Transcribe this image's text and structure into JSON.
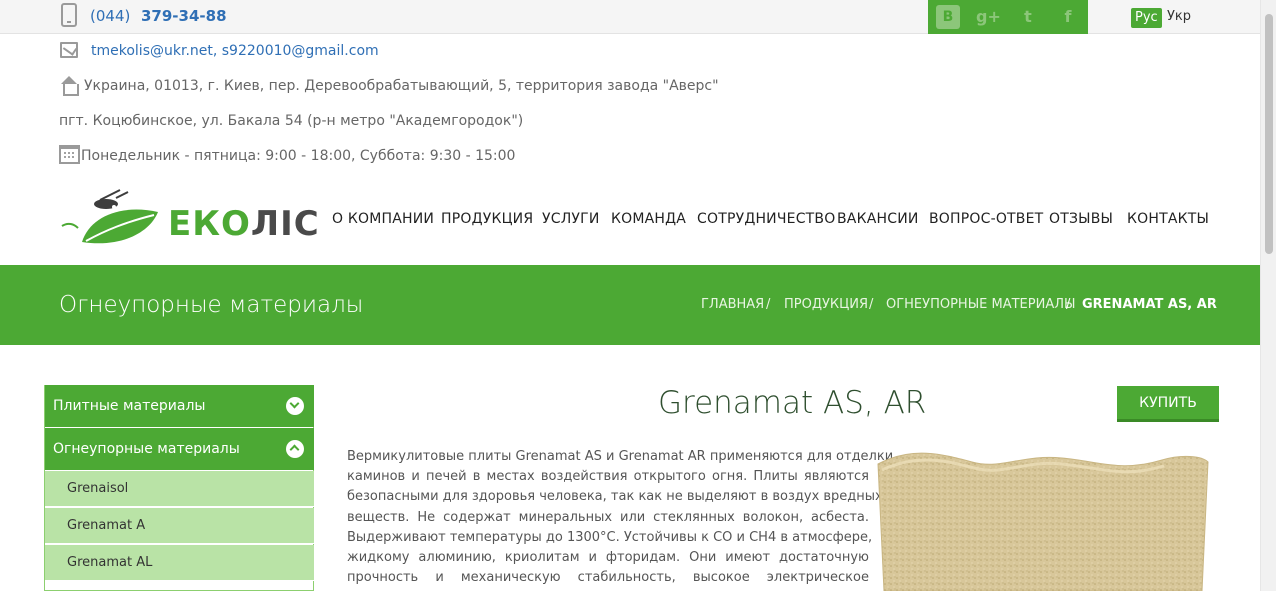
{
  "topbar": {
    "phone_icon": "mobile-phone-icon",
    "phone_code": "(044)",
    "phone_number": "379-34-88",
    "social_icons": [
      "vk-icon",
      "google-plus-icon",
      "twitter-icon",
      "facebook-icon"
    ],
    "social_glyphs": {
      "vk": "В",
      "gplus": "g+",
      "twitter": "t",
      "facebook": "f"
    },
    "lang_active": "Рус",
    "lang_other": "Укр"
  },
  "contacts": {
    "email": "tmekolis@ukr.net, s9220010@gmail.com",
    "address1": "Украина, 01013, г. Киев, пер. Деревообрабатывающий, 5, территория завода \"Аверс\"",
    "address2": "пгт. Коцюбинское, ул. Бакала 54 (р-н метро \"Академгородок\")",
    "hours": "Понедельник - пятница: 9:00 - 18:00, Суббота: 9:30 - 15:00"
  },
  "logo": {
    "text_a": "ЕКО",
    "text_b": "ЛІС"
  },
  "nav": [
    "О КОМПАНИИ",
    "ПРОДУКЦИЯ",
    "УСЛУГИ",
    "КОМАНДА",
    "СОТРУДНИЧЕСТВО",
    "ВАКАНСИИ",
    "ВОПРОС-ОТВЕТ",
    "ОТЗЫВЫ",
    "КОНТАКТЫ"
  ],
  "banner": {
    "title": "Огнеупорные материалы",
    "breadcrumbs": [
      "ГЛАВНАЯ",
      "ПРОДУКЦИЯ",
      "ОГНЕУПОРНЫЕ МАТЕРИАЛЫ",
      "GRENAMAT AS, AR"
    ],
    "separator": "/"
  },
  "sidebar": {
    "sections": [
      {
        "label": "Плитные материалы",
        "state": "collapsed"
      },
      {
        "label": "Огнеупорные материалы",
        "state": "expanded"
      }
    ],
    "items": [
      "Grenaisol",
      "Grenamat A",
      "Grenamat AL"
    ]
  },
  "product": {
    "title": "Grenamat AS, AR",
    "buy_label": "КУПИТЬ",
    "description_lines": [
      "Вермикулитовые плиты Grenamat AS и Grenamat AR применяются для отделки",
      "каминов и печей в местах воздействия открытого огня. Плиты являются",
      "безопасными для здоровья человека, так как не выделяют в воздух вредных",
      "веществ. Не содержат минеральных или стеклянных волокон, асбеста.",
      "Выдерживают температуры до 1300°C. Устойчивы к CO и CH4 в атмосфере,",
      "жидкому алюминию, криолитам и фторидам. Они имеют достаточную",
      "прочность и механическую стабильность, высокое электрическое"
    ]
  },
  "colors": {
    "brand_green": "#4ca934",
    "light_green": "#b9e3a6",
    "link_blue": "#2f6fb5"
  }
}
